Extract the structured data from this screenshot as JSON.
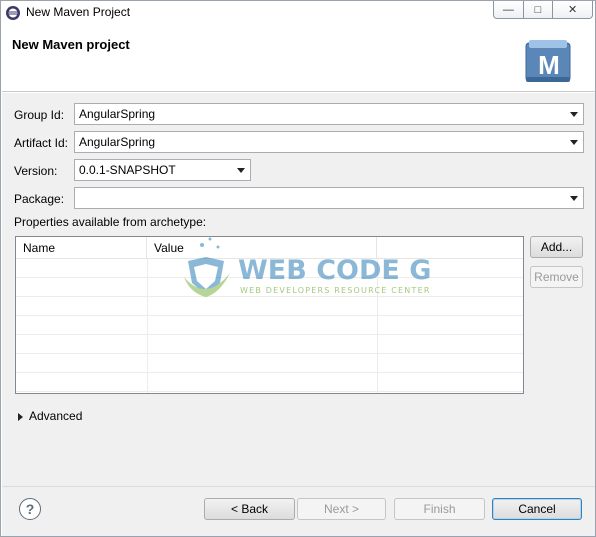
{
  "window": {
    "title": "New Maven Project",
    "minimize_glyph": "—",
    "maximize_glyph": "□",
    "close_glyph": "✕"
  },
  "banner": {
    "title": "New Maven project",
    "message": "",
    "logo_letter": "M"
  },
  "form": {
    "group_id": {
      "label": "Group Id:",
      "value": "AngularSpring"
    },
    "artifact_id": {
      "label": "Artifact Id:",
      "value": "AngularSpring"
    },
    "version": {
      "label": "Version:",
      "value": "0.0.1-SNAPSHOT"
    },
    "package": {
      "label": "Package:",
      "value": ""
    },
    "properties_label": "Properties available from archetype:"
  },
  "table": {
    "columns": [
      "Name",
      "Value"
    ],
    "rows": []
  },
  "buttons": {
    "add": "Add...",
    "remove": "Remove",
    "back": "< Back",
    "next": "Next >",
    "finish": "Finish",
    "cancel": "Cancel"
  },
  "advanced": {
    "label": "Advanced"
  },
  "help": {
    "glyph": "?"
  },
  "watermark": {
    "line1": "WEB CODE GEEKS",
    "line2": "WEB DEVELOPERS RESOURCE CENTER"
  },
  "colors": {
    "accent": "#3c7fb1",
    "watermark_blue": "#2f7fb8",
    "watermark_green": "#7cb342"
  }
}
